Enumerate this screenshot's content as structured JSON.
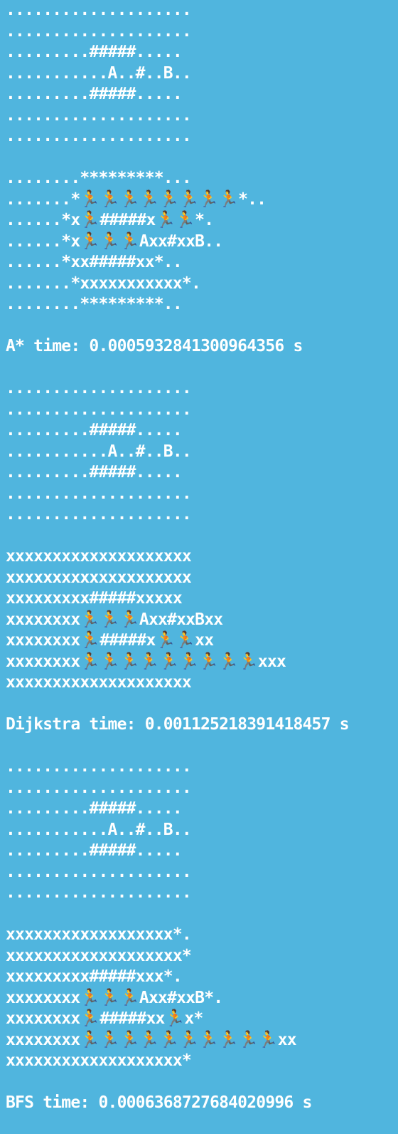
{
  "terminal": {
    "background_color": "#50b5de",
    "text_color": "#ffffff"
  },
  "astar": {
    "grid": [
      "....................",
      "....................",
      ".........#####.....",
      "...........A..#..B..",
      ".........#####.....",
      "....................",
      "...................."
    ],
    "result": [
      "........*********...",
      ".......*🏃🏃🏃🏃🏃🏃🏃🏃*..",
      "......*x🏃#####x🏃🏃*.",
      "......*x🏃🏃🏃Axx#xxB..",
      "......*xx#####xx*..",
      ".......*xxxxxxxxxxx*.",
      "........*********.."
    ],
    "time_label": "A* time: 0.0005932841300964356 s"
  },
  "dijkstra": {
    "grid": [
      "....................",
      "....................",
      ".........#####.....",
      "...........A..#..B..",
      ".........#####.....",
      "....................",
      "...................."
    ],
    "result": [
      "xxxxxxxxxxxxxxxxxxxx",
      "xxxxxxxxxxxxxxxxxxxx",
      "xxxxxxxxx#####xxxxx",
      "xxxxxxxx🏃🏃🏃Axx#xxBxx",
      "xxxxxxxx🏃#####x🏃🏃xx",
      "xxxxxxxx🏃🏃🏃🏃🏃🏃🏃🏃🏃xxx",
      "xxxxxxxxxxxxxxxxxxxx"
    ],
    "time_label": "Dijkstra time: 0.001125218391418457 s"
  },
  "bfs": {
    "grid": [
      "....................",
      "....................",
      ".........#####.....",
      "...........A..#..B..",
      ".........#####.....",
      "....................",
      "...................."
    ],
    "result": [
      "xxxxxxxxxxxxxxxxxx*.",
      "xxxxxxxxxxxxxxxxxxx*",
      "xxxxxxxxx#####xxx*.",
      "xxxxxxxx🏃🏃🏃Axx#xxB*.",
      "xxxxxxxx🏃#####xx🏃x*",
      "xxxxxxxx🏃🏃🏃🏃🏃🏃🏃🏃🏃🏃xx",
      "xxxxxxxxxxxxxxxxxxx*"
    ],
    "time_label": "BFS time: 0.0006368727684020996 s"
  }
}
